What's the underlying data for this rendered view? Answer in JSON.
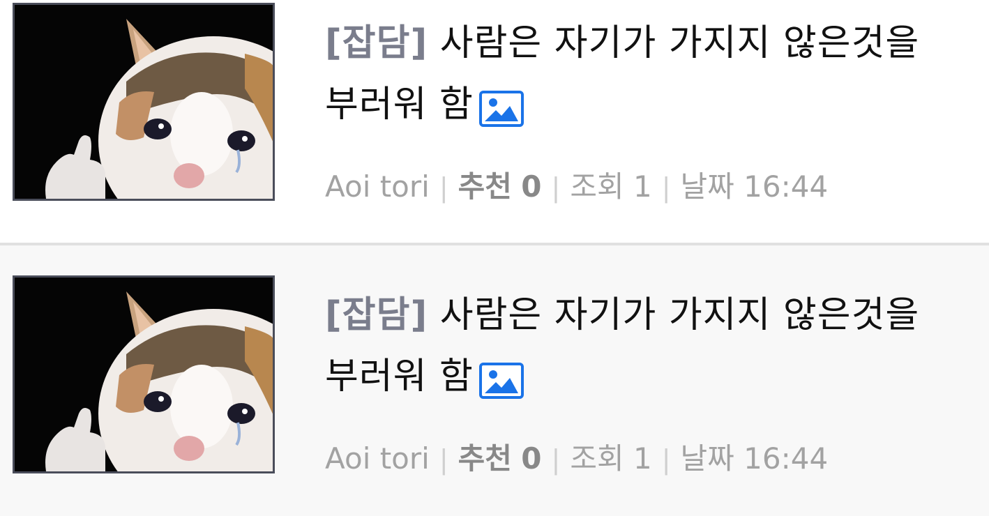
{
  "posts": [
    {
      "category": "[잡담]",
      "title": " 사람은 자기가 가지지 않은것을 부러워 함",
      "author": "Aoi tori",
      "recommend_label": "추천",
      "recommend_count": "0",
      "views_label": "조회",
      "views_count": "1",
      "date_label": "날짜",
      "date_value": "16:44",
      "thumbnail_icon": "crying-cat-thumbs-up",
      "attachment_icon": "image-icon"
    },
    {
      "category": "[잡담]",
      "title": " 사람은 자기가 가지지 않은것을 부러워 함",
      "author": "Aoi tori",
      "recommend_label": "추천",
      "recommend_count": "0",
      "views_label": "조회",
      "views_count": "1",
      "date_label": "날짜",
      "date_value": "16:44",
      "thumbnail_icon": "crying-cat-thumbs-up",
      "attachment_icon": "image-icon"
    }
  ],
  "colors": {
    "category": "#7a7d8c",
    "meta": "#a2a2a2",
    "icon_blue": "#1a73e8",
    "divider": "#e0e0e0"
  }
}
